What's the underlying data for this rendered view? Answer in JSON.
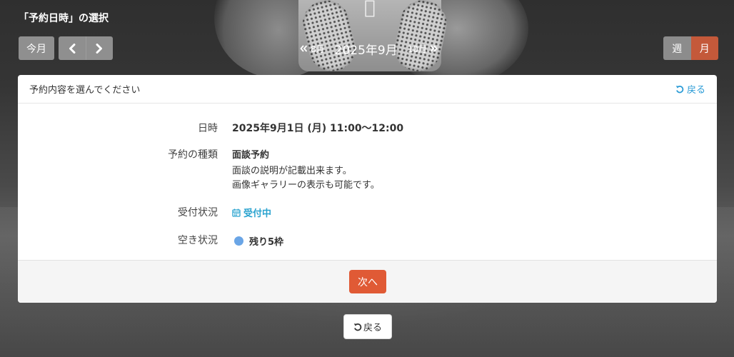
{
  "page": {
    "title": "「予約日時」の選択"
  },
  "toolbar": {
    "today_label": "今月",
    "prev_month": "8月",
    "current_month": "2025年9月",
    "next_month": "10月",
    "view_week": "週",
    "view_month": "月",
    "active_view": "月"
  },
  "panel": {
    "header_title": "予約内容を選んでください",
    "back_label": "戻る",
    "rows": {
      "datetime": {
        "label": "日時",
        "value": "2025年9月1日 (月) 11:00〜12:00"
      },
      "type": {
        "label": "予約の種類",
        "value": "面談予約",
        "desc1": "面談の説明が記載出来ます。",
        "desc2": "画像ギャラリーの表示も可能です。"
      },
      "status": {
        "label": "受付状況",
        "value": "受付中"
      },
      "availability": {
        "label": "空き状況",
        "value": "残り5枠"
      }
    },
    "next_label": "次へ"
  },
  "footer": {
    "back_label": "戻る"
  },
  "colors": {
    "accent": "#e05a35",
    "month_toggle": "#c4593a",
    "link": "#2a9bd6",
    "status_open": "#2aa3cf",
    "availability_dot": "#6aa5e6"
  }
}
